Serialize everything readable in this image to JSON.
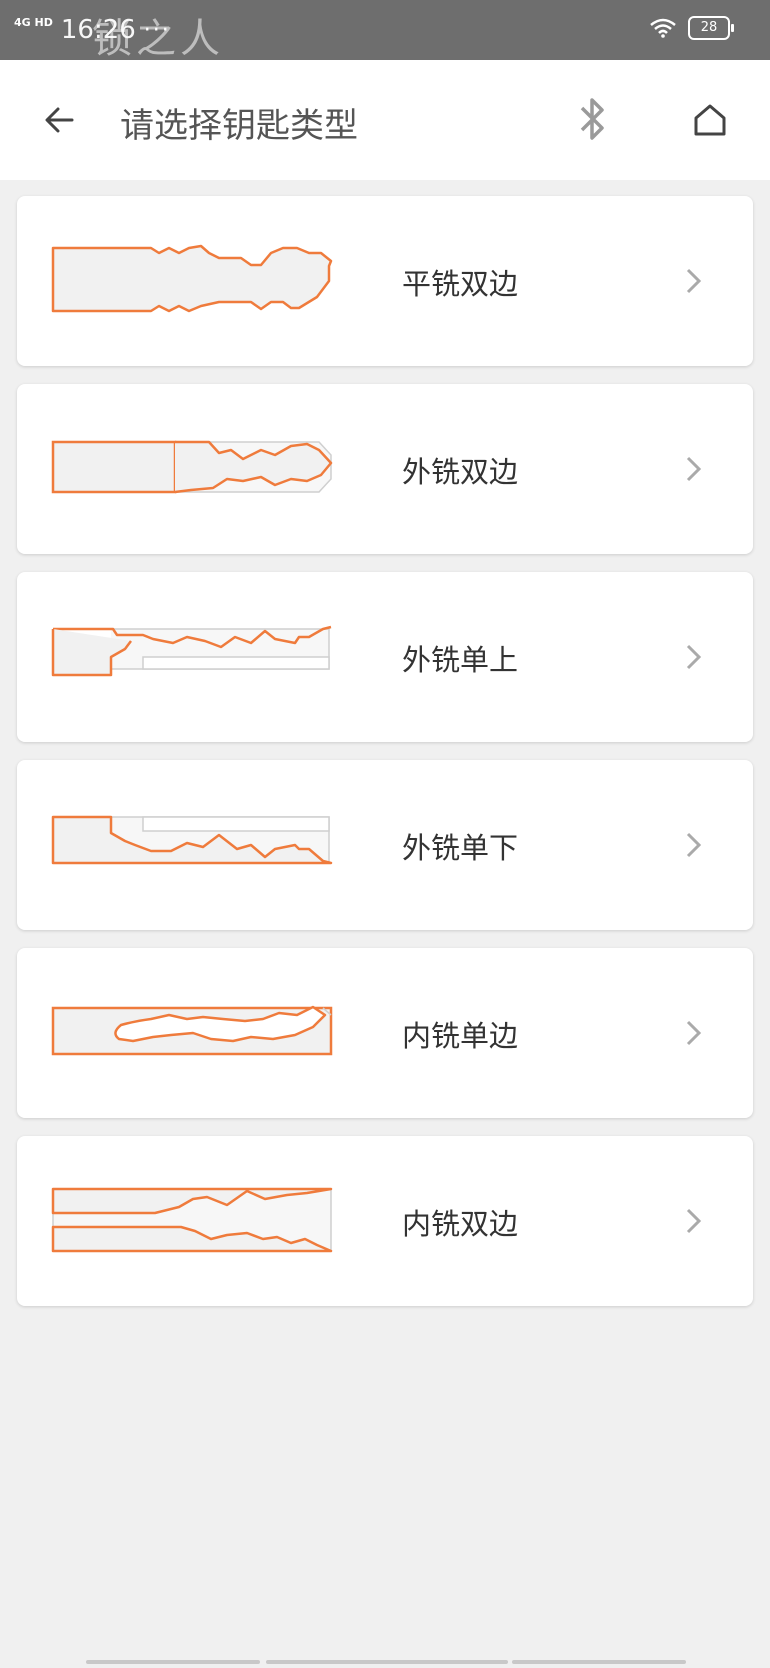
{
  "status_bar": {
    "network": "4G HD",
    "time": "16:26",
    "watermark": "锁之人",
    "more": "···",
    "battery": "28"
  },
  "header": {
    "title": "请选择钥匙类型",
    "icons": {
      "back": "arrow-left-icon",
      "bluetooth": "bluetooth-icon",
      "home": "home-icon"
    }
  },
  "key_types": [
    {
      "label": "平铣双边",
      "icon": "double-sided-flat-key-icon"
    },
    {
      "label": "外铣双边",
      "icon": "double-sided-outer-milled-key-icon"
    },
    {
      "label": "外铣单上",
      "icon": "single-upper-outer-milled-key-icon"
    },
    {
      "label": "外铣单下",
      "icon": "single-lower-outer-milled-key-icon"
    },
    {
      "label": "内铣单边",
      "icon": "single-internal-milled-key-icon"
    },
    {
      "label": "内铣双边",
      "icon": "double-internal-milled-key-icon"
    }
  ],
  "colors": {
    "accent": "#ef7b3c",
    "background": "#f0f0f0",
    "statusbar": "#6e6e6e"
  }
}
